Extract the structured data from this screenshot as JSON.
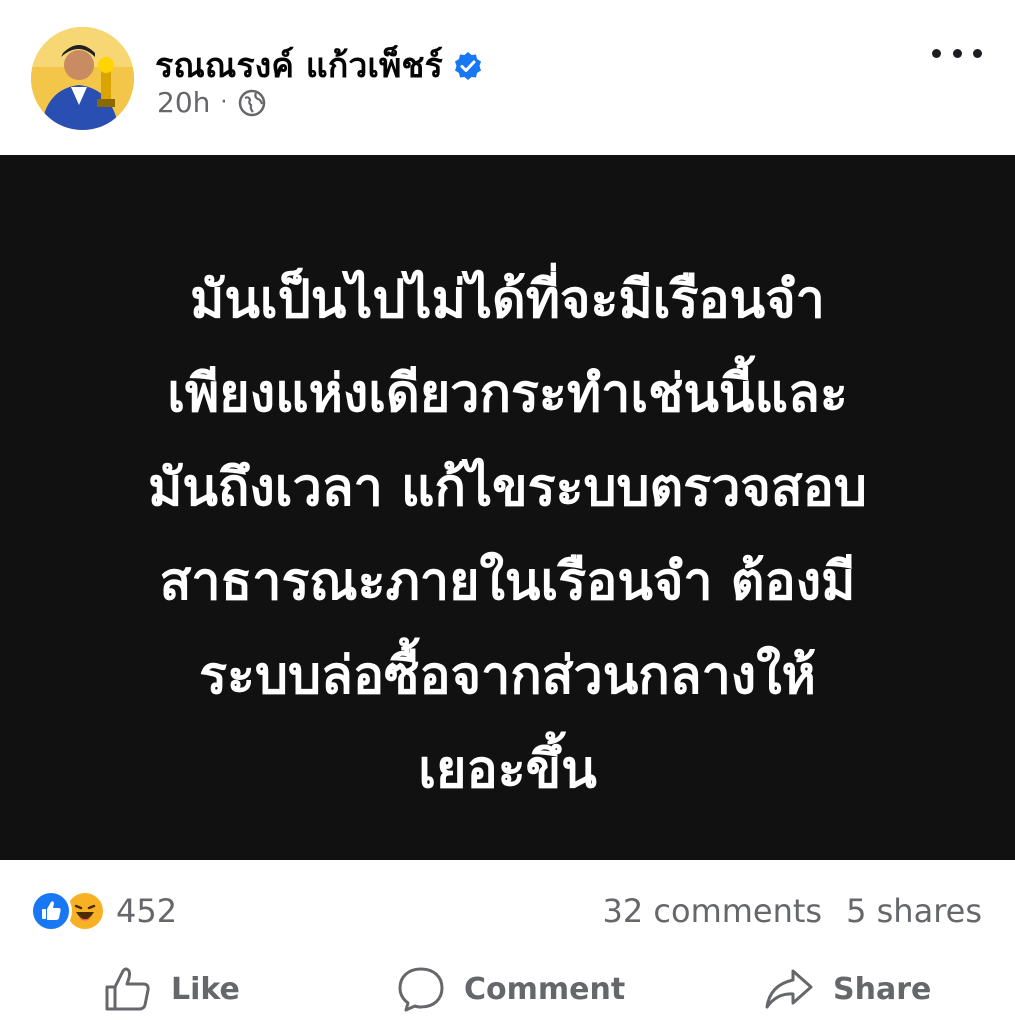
{
  "post": {
    "author_name": "รณณรงค์ แก้วเพ็ชร์",
    "timestamp": "20h",
    "separator": "·",
    "audience_icon": "globe-icon",
    "verified_icon": "verified-badge-icon",
    "more_icon": "more-options-icon",
    "panel_text": "มันเป็นไปไม่ได้ที่จะมีเรือนจำ\nเพียงแห่งเดียวกระทำเช่นนี้และ\nมันถึงเวลา แก้ไขระบบตรวจสอบ\nสาธารณะภายในเรือนจำ ต้องมี\nระบบล่อซื้อจากส่วนกลางให้\nเยอะขึ้น"
  },
  "stats": {
    "reaction_count": "452",
    "reaction_icons": [
      "like-reaction-icon",
      "haha-reaction-icon"
    ],
    "comments": "32 comments",
    "shares": "5 shares"
  },
  "actions": {
    "like": "Like",
    "comment": "Comment",
    "share": "Share"
  },
  "colors": {
    "panel_bg": "#111111",
    "verified_blue": "#1877f2",
    "secondary_text": "#65676b"
  }
}
